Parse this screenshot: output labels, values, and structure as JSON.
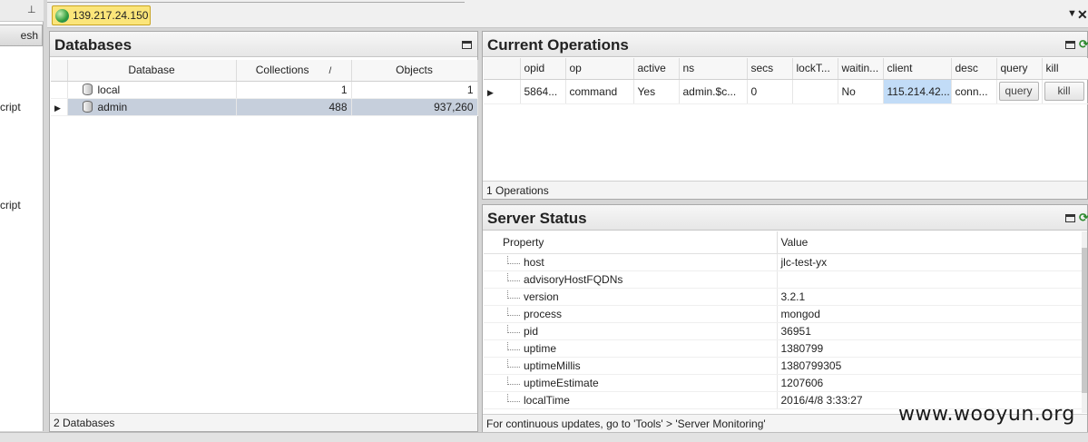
{
  "sidebar": {
    "refresh_label": "esh",
    "items": [
      "cript",
      "cript"
    ]
  },
  "tabs": {
    "server": "139.217.24.150"
  },
  "databases": {
    "title": "Databases",
    "columns": [
      "Database",
      "Collections",
      "Objects"
    ],
    "rows": [
      {
        "name": "local",
        "collections": "1",
        "objects": "1"
      },
      {
        "name": "admin",
        "collections": "488",
        "objects": "937,260"
      }
    ],
    "status": "2 Databases"
  },
  "operations": {
    "title": "Current Operations",
    "columns": [
      "opid",
      "op",
      "active",
      "ns",
      "secs",
      "lockT...",
      "waitin...",
      "client",
      "desc",
      "query",
      "kill"
    ],
    "row": {
      "opid": "5864...",
      "op": "command",
      "active": "Yes",
      "ns": "admin.$c...",
      "secs": "0",
      "lock": "",
      "waiting": "No",
      "client": "115.214.42...",
      "desc": "conn...",
      "query_button": "query",
      "kill_button": "kill"
    },
    "status": "1 Operations"
  },
  "server_status": {
    "title": "Server Status",
    "columns": [
      "Property",
      "Value"
    ],
    "rows": [
      {
        "property": "host",
        "value": "jlc-test-yx"
      },
      {
        "property": "advisoryHostFQDNs",
        "value": ""
      },
      {
        "property": "version",
        "value": "3.2.1"
      },
      {
        "property": "process",
        "value": "mongod"
      },
      {
        "property": "pid",
        "value": "36951"
      },
      {
        "property": "uptime",
        "value": "1380799"
      },
      {
        "property": "uptimeMillis",
        "value": "1380799305"
      },
      {
        "property": "uptimeEstimate",
        "value": "1207606"
      },
      {
        "property": "localTime",
        "value": "2016/4/8 3:33:27"
      }
    ],
    "status": "For continuous updates, go to 'Tools' > 'Server Monitoring'"
  },
  "watermark": "www.wooyun.org",
  "colors": {
    "tab_highlight": "#fbe57a",
    "selected_row": "#c6cfdc",
    "client_cell": "#c2dcf7"
  }
}
